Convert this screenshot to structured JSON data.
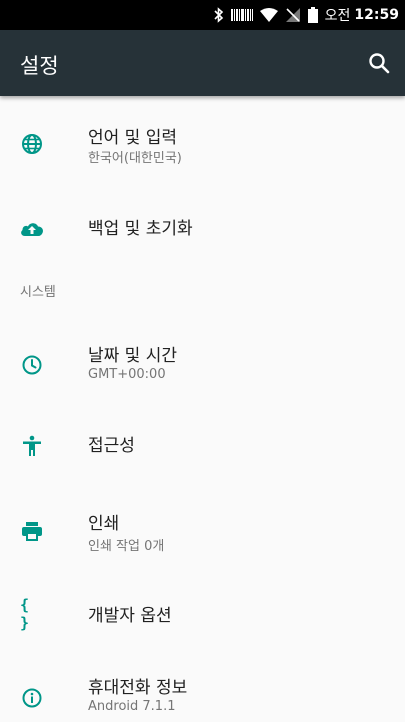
{
  "status_bar": {
    "icons": [
      "bluetooth-icon",
      "barcode-icon",
      "wifi-icon",
      "no-signal-icon",
      "battery-icon"
    ],
    "ampm": "오전",
    "time": "12:59"
  },
  "app_bar": {
    "title": "설정",
    "search_icon": "search-icon"
  },
  "items": [
    {
      "icon": "globe-icon",
      "title": "언어 및 입력",
      "subtitle": "한국어(대한민국)"
    },
    {
      "icon": "cloud-upload-icon",
      "title": "백업 및 초기화"
    }
  ],
  "section": {
    "header": "시스템"
  },
  "system_items": [
    {
      "icon": "clock-icon",
      "title": "날짜 및 시간",
      "subtitle": "GMT+00:00"
    },
    {
      "icon": "accessibility-icon",
      "title": "접근성"
    },
    {
      "icon": "printer-icon",
      "title": "인쇄",
      "subtitle": "인쇄 작업 0개"
    },
    {
      "icon": "braces-icon",
      "glyph": "{ }",
      "title": "개발자 옵션"
    },
    {
      "icon": "info-icon",
      "title": "휴대전화 정보",
      "subtitle": "Android 7.1.1"
    }
  ],
  "colors": {
    "status_bar": "#000000",
    "app_bar": "#263238",
    "accent": "#009688",
    "background": "#fafafa",
    "primary_text": "#212121",
    "secondary_text": "#757575"
  }
}
